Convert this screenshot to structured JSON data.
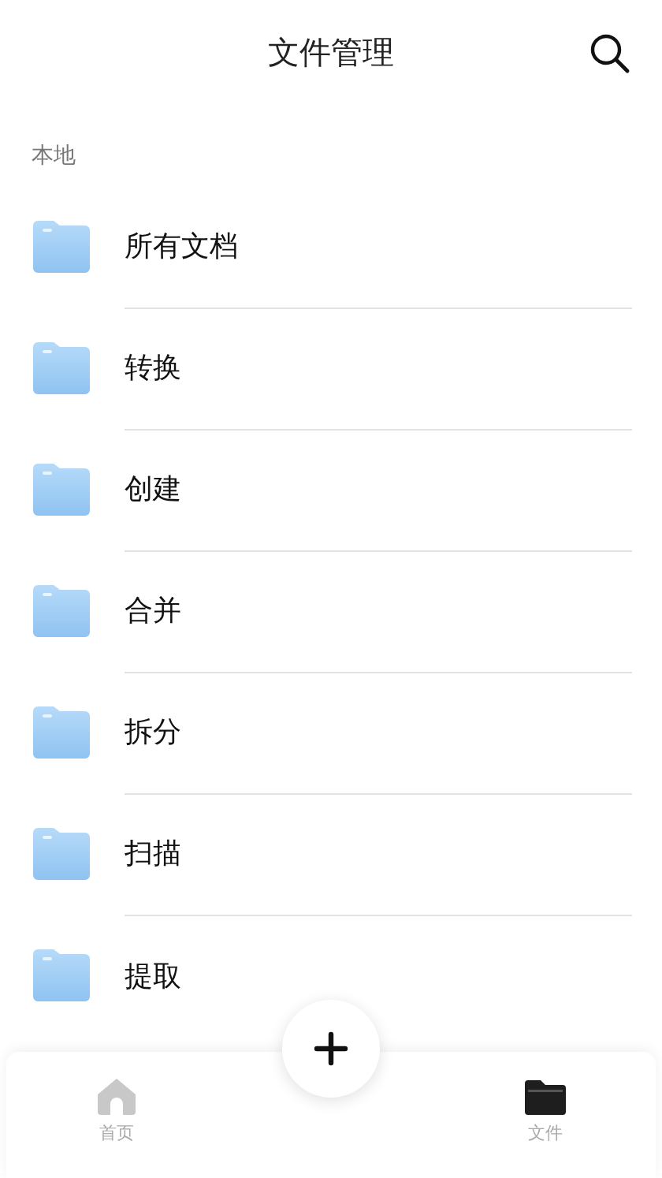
{
  "header": {
    "title": "文件管理"
  },
  "section": {
    "label": "本地"
  },
  "folders": [
    {
      "label": "所有文档"
    },
    {
      "label": "转换"
    },
    {
      "label": "创建"
    },
    {
      "label": "合并"
    },
    {
      "label": "拆分"
    },
    {
      "label": "扫描"
    },
    {
      "label": "提取"
    }
  ],
  "tab_bar": {
    "tabs": [
      {
        "kind": "home",
        "label": "首页",
        "selected": false
      },
      {
        "kind": "files",
        "label": "文件",
        "selected": true
      }
    ]
  }
}
